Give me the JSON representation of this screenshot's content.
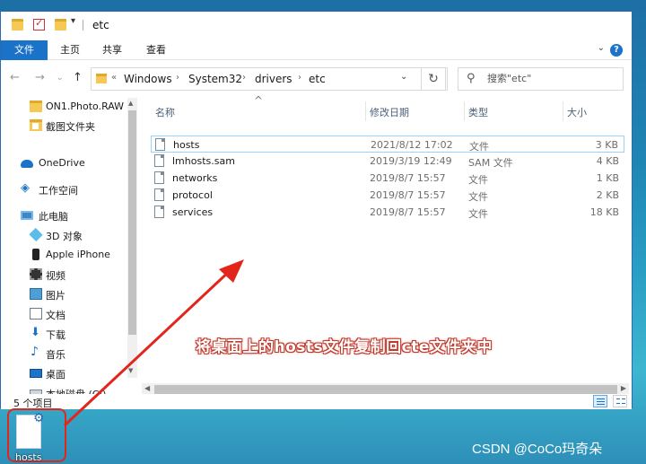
{
  "window": {
    "title": "etc"
  },
  "ribbon": {
    "tabs": [
      "文件",
      "主页",
      "共享",
      "查看"
    ],
    "active": 0,
    "help": "?"
  },
  "address": {
    "overflow": "«",
    "path": [
      "Windows",
      "System32",
      "drivers",
      "etc"
    ]
  },
  "search": {
    "placeholder": "搜索\"etc\""
  },
  "nav": {
    "items": [
      {
        "label": "ON1.Photo.RAW",
        "icon": "folder-icon"
      },
      {
        "label": "截图文件夹",
        "icon": "folder-icon"
      },
      {
        "label": "OneDrive",
        "icon": "cloud-icon"
      },
      {
        "label": "工作空间",
        "icon": "workspace-icon"
      },
      {
        "label": "此电脑",
        "icon": "computer-icon"
      },
      {
        "label": "3D 对象",
        "icon": "3d-objects-icon"
      },
      {
        "label": "Apple iPhone",
        "icon": "phone-icon"
      },
      {
        "label": "视频",
        "icon": "video-icon"
      },
      {
        "label": "图片",
        "icon": "pictures-icon"
      },
      {
        "label": "文档",
        "icon": "documents-icon"
      },
      {
        "label": "下载",
        "icon": "download-icon"
      },
      {
        "label": "音乐",
        "icon": "music-icon"
      },
      {
        "label": "桌面",
        "icon": "desktop-icon"
      },
      {
        "label": "本地磁盘 (C:)",
        "icon": "disk-icon"
      }
    ]
  },
  "columns": {
    "name": "名称",
    "date": "修改日期",
    "type": "类型",
    "size": "大小"
  },
  "files": [
    {
      "name": "hosts",
      "date": "2021/8/12 17:02",
      "type": "文件",
      "size": "3 KB"
    },
    {
      "name": "lmhosts.sam",
      "date": "2019/3/19 12:49",
      "type": "SAM 文件",
      "size": "4 KB"
    },
    {
      "name": "networks",
      "date": "2019/8/7 15:57",
      "type": "文件",
      "size": "1 KB"
    },
    {
      "name": "protocol",
      "date": "2019/8/7 15:57",
      "type": "文件",
      "size": "2 KB"
    },
    {
      "name": "services",
      "date": "2019/8/7 15:57",
      "type": "文件",
      "size": "18 KB"
    }
  ],
  "status": {
    "count": "5 个项目"
  },
  "desktop": {
    "icon_label": "hosts"
  },
  "annotation": {
    "text": "将桌面上的hosts文件复制回cte文件夹中",
    "color": "#e2261b"
  },
  "watermark": "CSDN @CoCo玛奇朵"
}
